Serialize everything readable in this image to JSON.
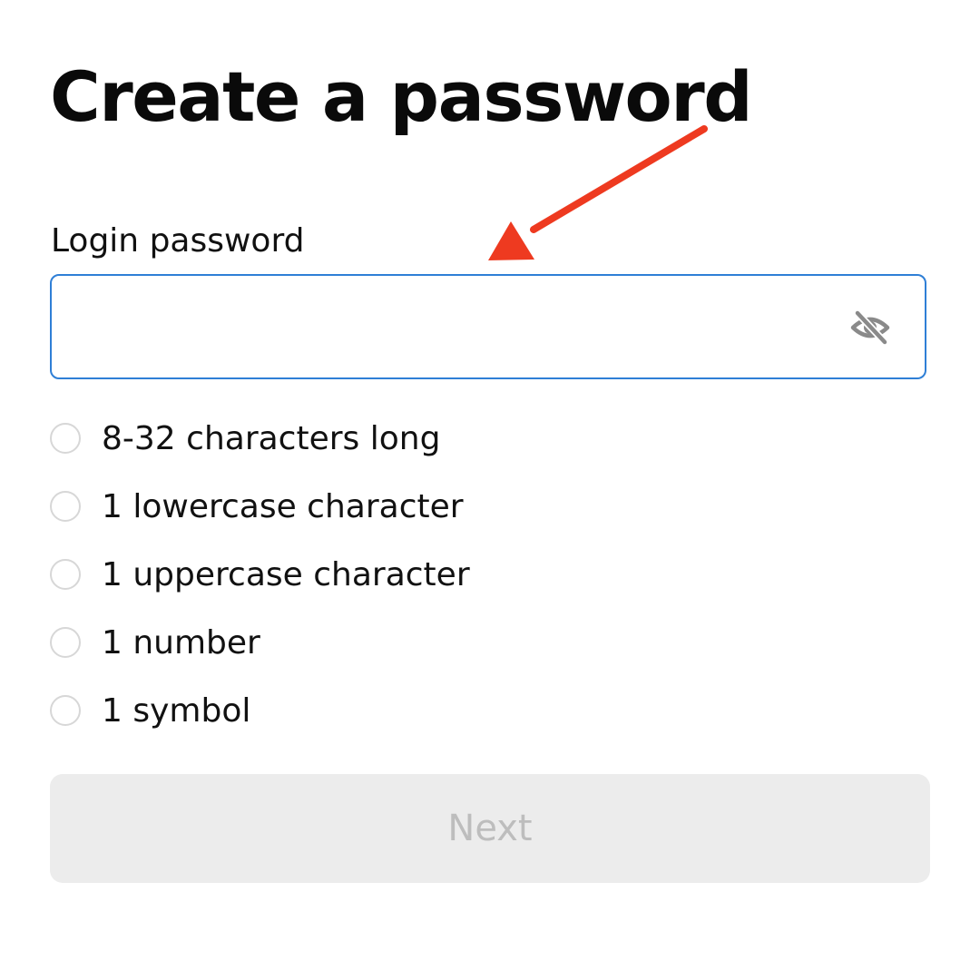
{
  "page": {
    "title": "Create a password"
  },
  "password_field": {
    "label": "Login password",
    "value": "",
    "placeholder": "",
    "toggle_icon": "eye-slash-icon",
    "border_color": "#2f7fd6"
  },
  "requirements": [
    {
      "label": "8-32 characters long",
      "met": false
    },
    {
      "label": "1 lowercase character",
      "met": false
    },
    {
      "label": "1 uppercase character",
      "met": false
    },
    {
      "label": "1 number",
      "met": false
    },
    {
      "label": "1 symbol",
      "met": false
    }
  ],
  "next_button": {
    "label": "Next",
    "enabled": false
  },
  "annotation": {
    "type": "arrow",
    "color": "#ee3a20",
    "icon": "arrow-annotation"
  }
}
